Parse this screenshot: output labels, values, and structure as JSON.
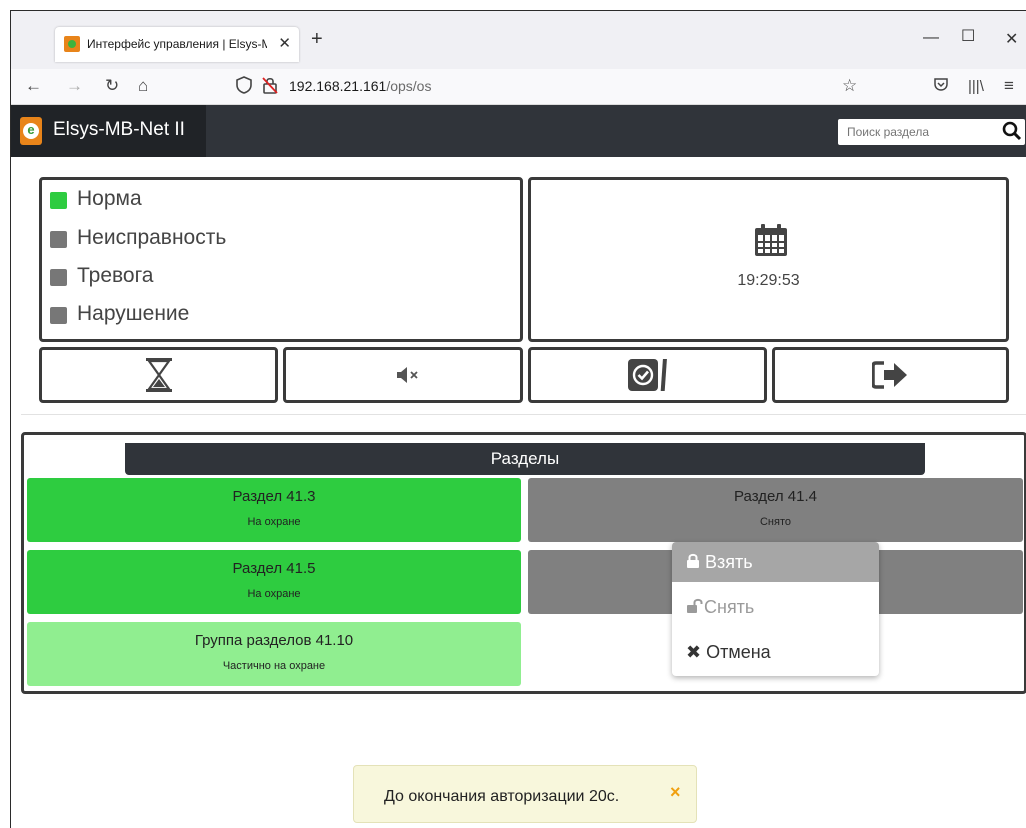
{
  "browser": {
    "tab_title": "Интерфейс управления | Elsys-MB-Net II",
    "url_host": "192.168.21.161",
    "url_path": "/ops/os"
  },
  "app": {
    "brand": "Elsys-MB-Net II",
    "search_placeholder": "Поиск раздела"
  },
  "status": {
    "items": [
      {
        "label": "Норма",
        "color": "#2ecc40"
      },
      {
        "label": "Неисправность",
        "color": "#777777"
      },
      {
        "label": "Тревога",
        "color": "#777777"
      },
      {
        "label": "Нарушение",
        "color": "#777777"
      }
    ],
    "time": "19:29:53"
  },
  "sections": {
    "title": "Разделы",
    "tiles": [
      {
        "name": "Раздел 41.3",
        "state": "На охране",
        "color": "#2ecc40"
      },
      {
        "name": "Раздел 41.4",
        "state": "Снято",
        "color": "#808080"
      },
      {
        "name": "Раздел 41.5",
        "state": "На охране",
        "color": "#2ecc40"
      },
      {
        "name": "",
        "state": "",
        "color": "#808080"
      },
      {
        "name": "Группа разделов 41.10",
        "state": "Частично на охране",
        "color": "#90ee90"
      }
    ]
  },
  "context_menu": {
    "arm": "Взять",
    "disarm": "Снять",
    "cancel": "Отмена"
  },
  "toast": {
    "text": "До окончания авторизации 20с.",
    "close": "×"
  },
  "colors": {
    "header_bg": "#30343a",
    "accent_green": "#2ecc40",
    "toast_close": "#f0a010"
  }
}
